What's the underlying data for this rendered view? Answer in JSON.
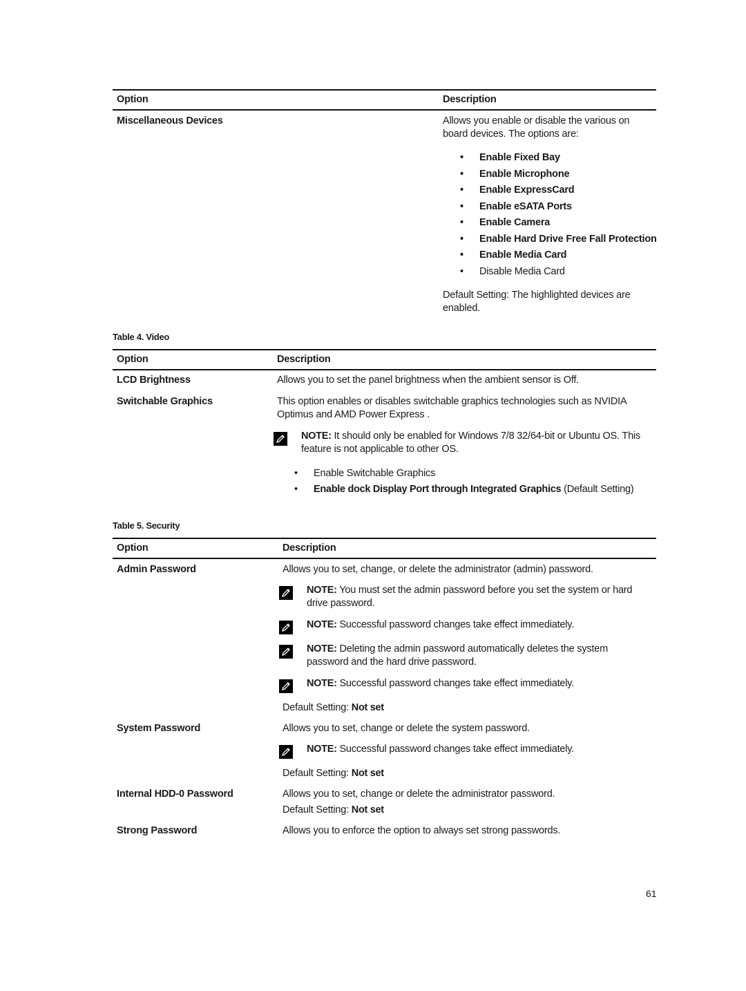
{
  "table_misc": {
    "header": {
      "option": "Option",
      "description": "Description"
    },
    "row": {
      "option": "Miscellaneous Devices",
      "description": [
        "Allows you enable or disable the various on",
        "board devices. The options are:"
      ],
      "items": [
        {
          "label": "Enable Fixed Bay",
          "highlighted": true
        },
        {
          "label": "Enable Microphone",
          "highlighted": true
        },
        {
          "label": "Enable ExpressCard",
          "highlighted": true
        },
        {
          "label": "Enable eSATA Ports",
          "highlighted": true
        },
        {
          "label": "Enable Camera",
          "highlighted": true
        },
        {
          "label": "Enable Hard Drive Free Fall Protection",
          "highlighted": true
        },
        {
          "label": "Enable Media Card",
          "highlighted": true
        },
        {
          "label": "Disable Media Card",
          "highlighted": false
        }
      ],
      "default": [
        "Default Setting: The highlighted devices are",
        "enabled."
      ]
    }
  },
  "table_video": {
    "caption": "Table 4. Video",
    "header": {
      "option": "Option",
      "description": "Description"
    },
    "rows": [
      {
        "option": "LCD Brightness",
        "description": "Allows you to set the panel brightness when the ambient sensor is Off."
      },
      {
        "option": "Switchable Graphics",
        "description": [
          "This option enables or disables switchable graphics technologies such as NVIDIA",
          "Optimus and AMD Power Express ."
        ],
        "note": {
          "label": "NOTE:",
          "text": [
            "It should only be enabled for Windows 7/8 32/64-bit or Ubuntu OS. This",
            "feature is not applicable to other OS."
          ]
        },
        "items": [
          {
            "label": "Enable Switchable Graphics"
          },
          {
            "label": "Enable dock Display Port through Integrated Graphics",
            "suffix": "(Default Setting)"
          }
        ]
      }
    ]
  },
  "table_security": {
    "caption": "Table 5. Security",
    "header": {
      "option": "Option",
      "description": "Description"
    },
    "rows": [
      {
        "option": "Admin Password",
        "description": "Allows you to set, change, or delete the administrator (admin) password.",
        "notes": [
          {
            "label": "NOTE:",
            "text": [
              "You must set the admin password before you set the system or hard",
              "drive password."
            ]
          },
          {
            "label": "NOTE:",
            "text": [
              "Successful password changes take effect immediately."
            ]
          },
          {
            "label": "NOTE:",
            "text": [
              "Deleting the admin password automatically deletes the system",
              "password and the hard drive password."
            ]
          },
          {
            "label": "NOTE:",
            "text": [
              "Successful password changes take effect immediately."
            ]
          }
        ],
        "default_label": "Default Setting:",
        "default_value": "Not set"
      },
      {
        "option": "System Password",
        "description": "Allows you to set, change or delete the system password.",
        "notes": [
          {
            "label": "NOTE:",
            "text": [
              "Successful password changes take effect immediately."
            ]
          }
        ],
        "default_label": "Default Setting:",
        "default_value": "Not set"
      },
      {
        "option": "Internal HDD-0 Password",
        "description": "Allows you to set, change or delete the administrator password.",
        "default_label": "Default Setting:",
        "default_value": "Not set"
      },
      {
        "option": "Strong Password",
        "description": "Allows you to enforce the option to always set strong passwords."
      }
    ]
  },
  "page_number": "61"
}
